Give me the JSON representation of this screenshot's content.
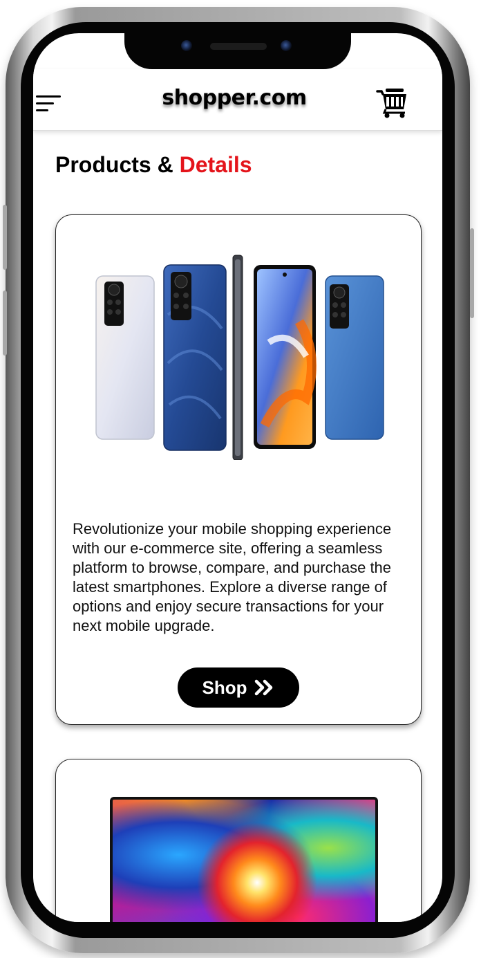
{
  "header": {
    "logo_text": "shopper.com",
    "menu_icon": "hamburger-menu-icon",
    "cart_icon": "shopping-cart-icon"
  },
  "page": {
    "title_part1": "Products & ",
    "title_part2": "Details",
    "accent_color": "#e4141b"
  },
  "products": [
    {
      "image_icon": "smartphones-image",
      "description": "Revolutionize your mobile shopping experience with our e-commerce site, offering a seamless platform to browse, compare, and purchase the latest smartphones. Explore a diverse range of options and enjoy secure transactions for your next mobile upgrade.",
      "button_label": "Shop",
      "button_icon": "double-chevron-right-icon"
    },
    {
      "image_icon": "laptop-image"
    }
  ]
}
